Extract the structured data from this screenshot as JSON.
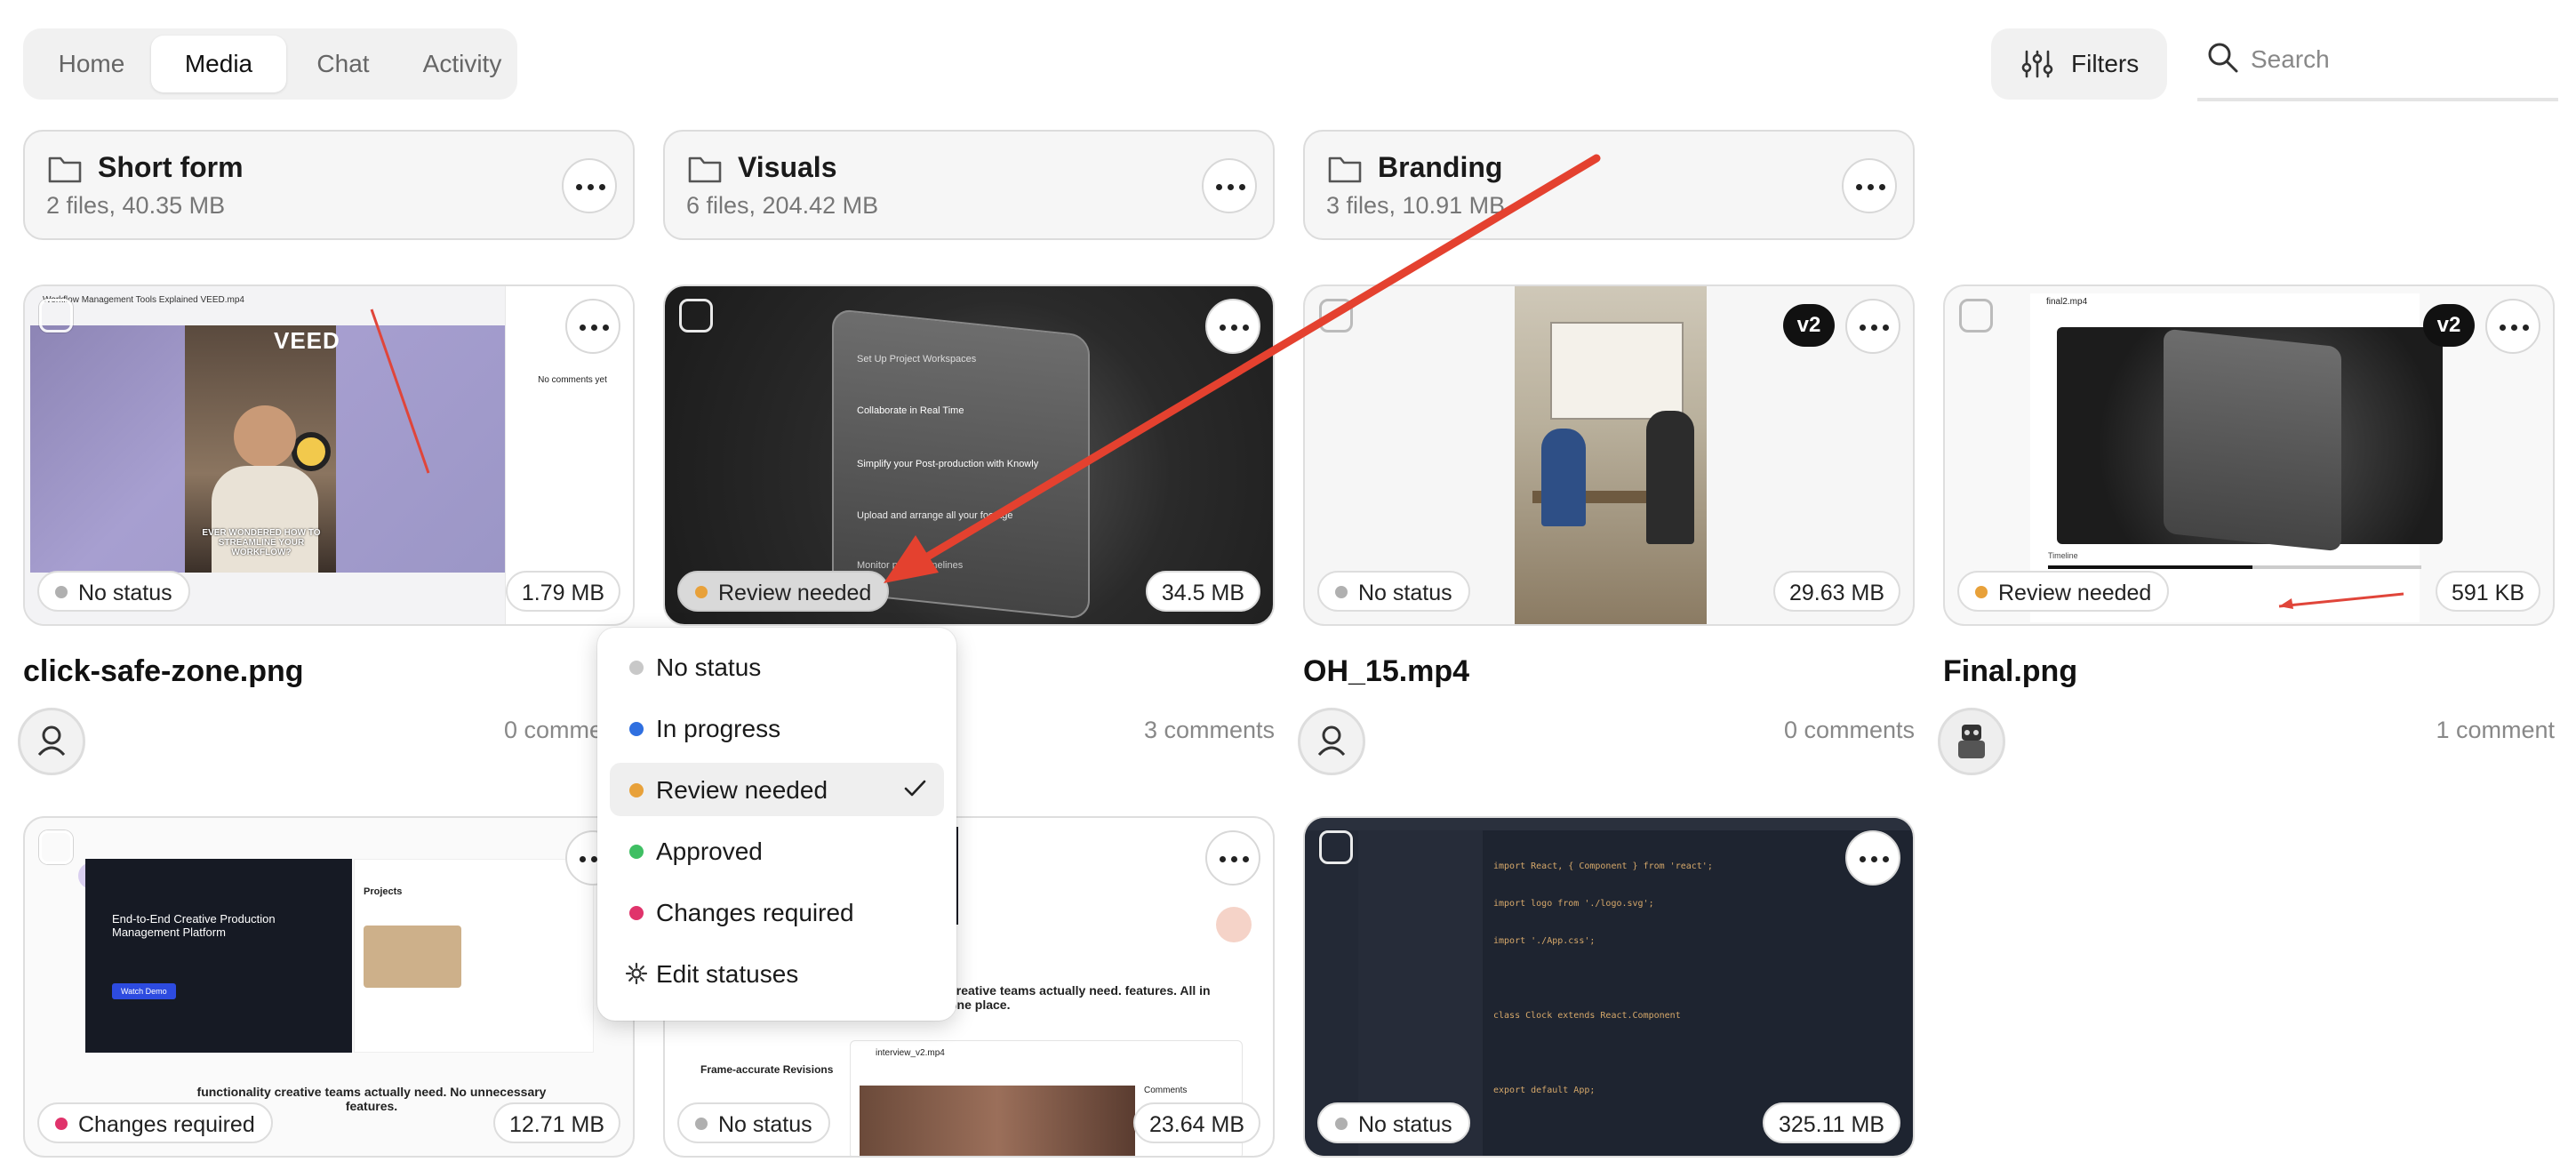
{
  "nav": {
    "tabs": [
      {
        "label": "Home",
        "active": false
      },
      {
        "label": "Media",
        "active": true
      },
      {
        "label": "Chat",
        "active": false
      },
      {
        "label": "Activity",
        "active": false
      }
    ],
    "filters_label": "Filters",
    "search_placeholder": "Search"
  },
  "folders": [
    {
      "name": "Short form",
      "meta": "2 files, 40.35 MB"
    },
    {
      "name": "Visuals",
      "meta": "6 files, 204.42 MB"
    },
    {
      "name": "Branding",
      "meta": "3 files, 10.91 MB"
    }
  ],
  "cards": [
    {
      "status": "No status",
      "status_color": "#b0b0b0",
      "size": "1.79 MB",
      "title": "click-safe-zone.png",
      "comments": "0 comments",
      "version": ""
    },
    {
      "status": "Review needed",
      "status_color": "#e8a13a",
      "size": "34.5 MB",
      "title": "",
      "comments": "3 comments",
      "version": ""
    },
    {
      "status": "No status",
      "status_color": "#b0b0b0",
      "size": "29.63 MB",
      "title": "OH_15.mp4",
      "comments": "0 comments",
      "version": "v2"
    },
    {
      "status": "Review needed",
      "status_color": "#e8a13a",
      "size": "591 KB",
      "title": "Final.png",
      "comments": "1 comment",
      "version": "v2"
    },
    {
      "status": "Changes required",
      "status_color": "#e0336b",
      "size": "12.71 MB"
    },
    {
      "status": "No status",
      "status_color": "#b0b0b0",
      "size": "23.64 MB"
    },
    {
      "status": "No status",
      "status_color": "#b0b0b0",
      "size": "325.11 MB"
    }
  ],
  "status_menu": {
    "items": [
      {
        "label": "No status",
        "color": "#c8c8c8",
        "selected": false
      },
      {
        "label": "In progress",
        "color": "#2f6fe0",
        "selected": false
      },
      {
        "label": "Review needed",
        "color": "#e8a13a",
        "selected": true
      },
      {
        "label": "Approved",
        "color": "#3fbf63",
        "selected": false
      },
      {
        "label": "Changes required",
        "color": "#e0336b",
        "selected": false
      }
    ],
    "edit_label": "Edit statuses"
  },
  "thumb_text": {
    "veed_header": "Workflow Management Tools Explained VEED.mp4",
    "veed_brand": "VEED",
    "veed_caption": "EVER WONDERED HOW TO STREAMLINE YOUR WORKFLOW?",
    "veed_no_comments": "No comments yet",
    "visual_steps": [
      "Set Up Project Workspaces",
      "Collaborate in Real Time",
      "Simplify your Post-production with Knowly",
      "Upload and arrange all your footage",
      "Monitor project timelines"
    ],
    "final_file": "final2.mp4",
    "final_timeline": "Timeline",
    "kreatli_hero": "End-to-End Creative Production Management Platform",
    "kreatli_btn": "Watch Demo",
    "kreatli_tagline": "functionality creative teams actually need. No unnecessary features.",
    "kreatli_projects": "Projects",
    "rev_tagline": "creative teams actually need. features. All in one place.",
    "rev_heading": "Frame-accurate Revisions",
    "rev_file": "interview_v2.mp4",
    "rev_comments": "Comments",
    "code_lines": [
      "import React, { Component } from 'react';",
      "import logo from './logo.svg';",
      "import './App.css';",
      "",
      "class Clock extends React.Component",
      "",
      "export default App;"
    ]
  }
}
